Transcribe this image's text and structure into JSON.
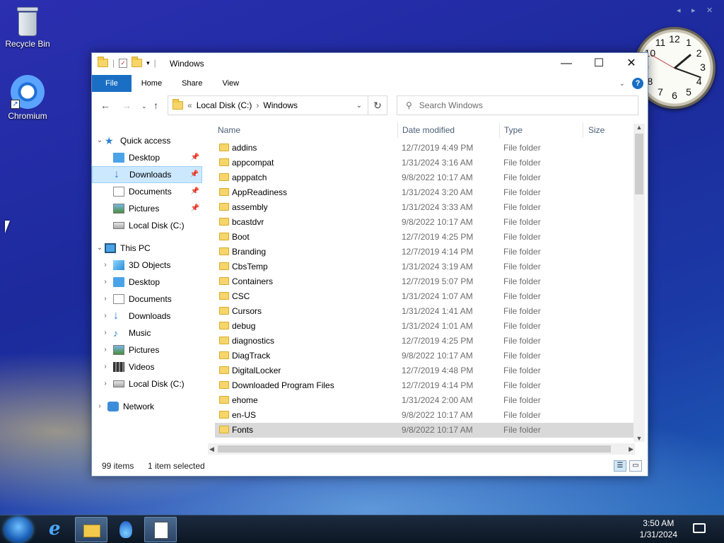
{
  "desktop": {
    "icons": [
      {
        "label": "Recycle Bin",
        "icon": "recycle-bin-icon"
      },
      {
        "label": "Chromium",
        "icon": "chromium-icon"
      }
    ]
  },
  "clock": {
    "numerals": [
      "12",
      "1",
      "2",
      "3",
      "4",
      "5",
      "6",
      "7",
      "8",
      "9",
      "10",
      "11"
    ]
  },
  "window": {
    "title": "Windows",
    "controls": {
      "minimize": "—",
      "maximize": "☐",
      "close": "✕"
    },
    "ribbon_tabs": [
      "File",
      "Home",
      "Share",
      "View"
    ],
    "help": "?",
    "address": {
      "prefix": "«",
      "crumbs": [
        "Local Disk (C:)",
        "Windows"
      ],
      "sep": "›"
    },
    "search_placeholder": "Search Windows",
    "nav": {
      "quick_access": "Quick access",
      "quick_items": [
        "Desktop",
        "Downloads",
        "Documents",
        "Pictures",
        "Local Disk (C:)"
      ],
      "this_pc": "This PC",
      "pc_items": [
        "3D Objects",
        "Desktop",
        "Documents",
        "Downloads",
        "Music",
        "Pictures",
        "Videos",
        "Local Disk (C:)"
      ],
      "network": "Network"
    },
    "columns": [
      "Name",
      "Date modified",
      "Type",
      "Size"
    ],
    "files": [
      {
        "name": "addins",
        "date": "12/7/2019 4:49 PM",
        "type": "File folder"
      },
      {
        "name": "appcompat",
        "date": "1/31/2024 3:16 AM",
        "type": "File folder"
      },
      {
        "name": "apppatch",
        "date": "9/8/2022 10:17 AM",
        "type": "File folder"
      },
      {
        "name": "AppReadiness",
        "date": "1/31/2024 3:20 AM",
        "type": "File folder"
      },
      {
        "name": "assembly",
        "date": "1/31/2024 3:33 AM",
        "type": "File folder"
      },
      {
        "name": "bcastdvr",
        "date": "9/8/2022 10:17 AM",
        "type": "File folder"
      },
      {
        "name": "Boot",
        "date": "12/7/2019 4:25 PM",
        "type": "File folder"
      },
      {
        "name": "Branding",
        "date": "12/7/2019 4:14 PM",
        "type": "File folder"
      },
      {
        "name": "CbsTemp",
        "date": "1/31/2024 3:19 AM",
        "type": "File folder"
      },
      {
        "name": "Containers",
        "date": "12/7/2019 5:07 PM",
        "type": "File folder"
      },
      {
        "name": "CSC",
        "date": "1/31/2024 1:07 AM",
        "type": "File folder"
      },
      {
        "name": "Cursors",
        "date": "1/31/2024 1:41 AM",
        "type": "File folder"
      },
      {
        "name": "debug",
        "date": "1/31/2024 1:01 AM",
        "type": "File folder"
      },
      {
        "name": "diagnostics",
        "date": "12/7/2019 4:25 PM",
        "type": "File folder"
      },
      {
        "name": "DiagTrack",
        "date": "9/8/2022 10:17 AM",
        "type": "File folder"
      },
      {
        "name": "DigitalLocker",
        "date": "12/7/2019 4:48 PM",
        "type": "File folder"
      },
      {
        "name": "Downloaded Program Files",
        "date": "12/7/2019 4:14 PM",
        "type": "File folder"
      },
      {
        "name": "ehome",
        "date": "1/31/2024 2:00 AM",
        "type": "File folder"
      },
      {
        "name": "en-US",
        "date": "9/8/2022 10:17 AM",
        "type": "File folder"
      },
      {
        "name": "Fonts",
        "date": "9/8/2022 10:17 AM",
        "type": "File folder"
      }
    ],
    "status": {
      "count": "99 items",
      "selected": "1 item selected"
    }
  },
  "taskbar": {
    "time": "3:50 AM",
    "date": "1/31/2024"
  }
}
